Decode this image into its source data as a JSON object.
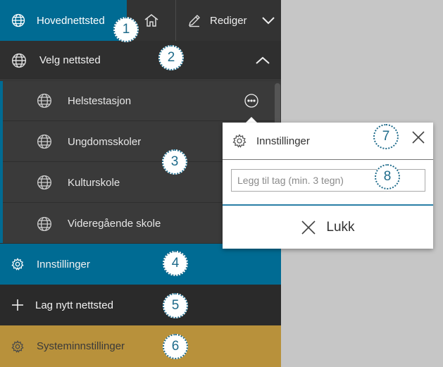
{
  "topbar": {
    "site_label": "Hovednettsted",
    "edit_label": "Rediger",
    "icons": [
      "globe-icon",
      "home-icon",
      "pencil-icon",
      "chevron-down-icon"
    ]
  },
  "site_select": {
    "label": "Velg nettsted"
  },
  "sites": [
    {
      "label": "Helstestasjon"
    },
    {
      "label": "Ungdomsskoler"
    },
    {
      "label": "Kulturskole"
    },
    {
      "label": "Videregående skole"
    }
  ],
  "menu": {
    "settings_label": "Innstillinger",
    "new_site_label": "Lag nytt nettsted",
    "system_label": "Systeminnstillinger"
  },
  "popover": {
    "title": "Innstillinger",
    "tag_placeholder": "Legg til tag (min. 3 tegn)",
    "close_label": "Lukk"
  },
  "badges": [
    "1",
    "2",
    "3",
    "4",
    "5",
    "6",
    "7",
    "8"
  ],
  "colors": {
    "accent": "#006b93",
    "panel": "#2f2f2f",
    "system": "#b8913b",
    "background": "#c6c6c6"
  }
}
